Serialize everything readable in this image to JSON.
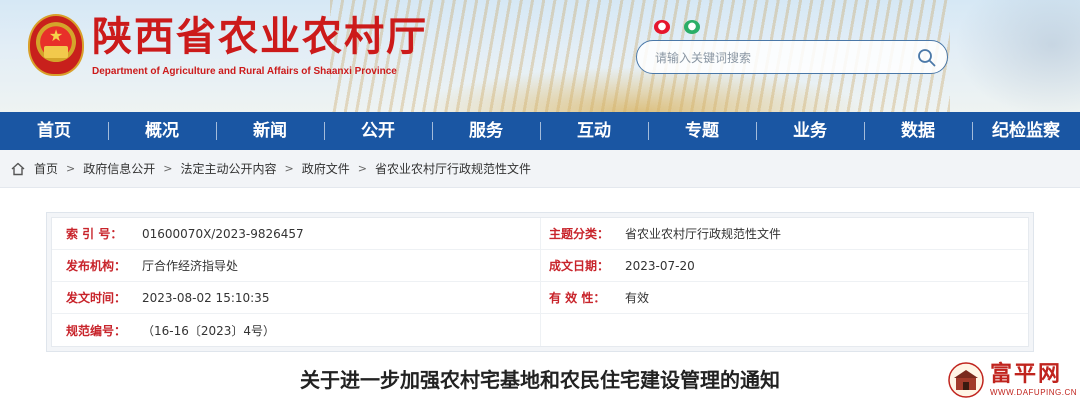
{
  "header": {
    "title": "陕西省农业农村厅",
    "subtitle": "Department of Agriculture and Rural Affairs of Shaanxi Province",
    "search_placeholder": "请输入关键词搜索",
    "social_icons": [
      "weibo-icon",
      "wechat-icon"
    ]
  },
  "nav": {
    "items": [
      "首页",
      "概况",
      "新闻",
      "公开",
      "服务",
      "互动",
      "专题",
      "业务",
      "数据",
      "纪检监察"
    ]
  },
  "breadcrumb": {
    "items": [
      "首页",
      "政府信息公开",
      "法定主动公开内容",
      "政府文件",
      "省农业农村厅行政规范性文件"
    ],
    "separator": ">"
  },
  "info": {
    "index_label": "索 引 号：",
    "index_value": "01600070X/2023-9826457",
    "subject_label": "主题分类：",
    "subject_value": "省农业农村厅行政规范性文件",
    "issuer_label": "发布机构：",
    "issuer_value": "厅合作经济指导处",
    "date_label": "成文日期：",
    "date_value": "2023-07-20",
    "time_label": "发文时间：",
    "time_value": "2023-08-02 15:10:35",
    "valid_label": "有 效 性：",
    "valid_value": "有效",
    "code_label": "规范编号：",
    "code_value": "（16-16〔2023〕4号）"
  },
  "article": {
    "title": "关于进一步加强农村宅基地和农民住宅建设管理的通知"
  },
  "watermark": {
    "text": "富平网",
    "url": "WWW.DAFUPING.CN"
  },
  "colors": {
    "nav_bg": "#1a56a3",
    "title_red": "#cc1a1a",
    "label_red": "#c8242b"
  }
}
